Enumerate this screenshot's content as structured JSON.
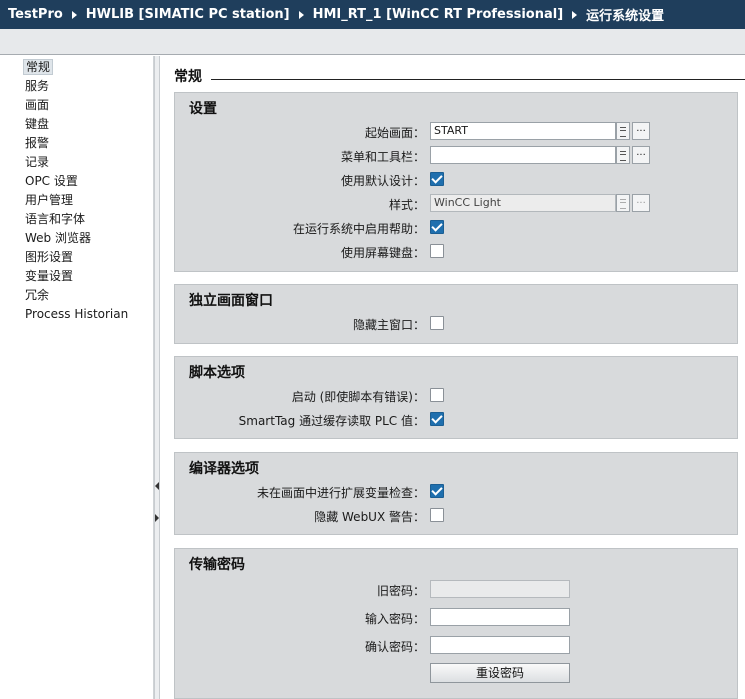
{
  "breadcrumb": [
    "TestPro",
    "HWLIB [SIMATIC PC station]",
    "HMI_RT_1 [WinCC RT Professional]",
    "运行系统设置"
  ],
  "nav": {
    "items": [
      "常规",
      "服务",
      "画面",
      "键盘",
      "报警",
      "记录",
      "OPC 设置",
      "用户管理",
      "语言和字体",
      "Web 浏览器",
      "图形设置",
      "变量设置",
      "冗余",
      "Process Historian"
    ],
    "selected": "常规"
  },
  "page": {
    "title": "常规"
  },
  "settings": {
    "title": "设置",
    "start_screen_label": "起始画面：",
    "start_screen_value": "START",
    "menu_toolbar_label": "菜单和工具栏：",
    "menu_toolbar_value": "",
    "use_default_design_label": "使用默认设计：",
    "use_default_design_checked": true,
    "style_label": "样式：",
    "style_value": "WinCC Light",
    "enable_help_label": "在运行系统中启用帮助：",
    "enable_help_checked": true,
    "screen_keyboard_label": "使用屏幕键盘：",
    "screen_keyboard_checked": false,
    "dots": "..."
  },
  "standalone_window": {
    "title": "独立画面窗口",
    "hide_main_window_label": "隐藏主窗口：",
    "hide_main_window_checked": false
  },
  "script_options": {
    "title": "脚本选项",
    "start_label": "启动 (即使脚本有错误)：",
    "start_checked": false,
    "smarttag_label": "SmartTag 通过缓存读取 PLC 值：",
    "smarttag_checked": true
  },
  "compiler_options": {
    "title": "编译器选项",
    "ext_check_label": "未在画面中进行扩展变量检查：",
    "ext_check_checked": true,
    "hide_webux_label": "隐藏 WebUX 警告：",
    "hide_webux_checked": false
  },
  "transfer_password": {
    "title": "传输密码",
    "old_password_label": "旧密码：",
    "old_password_value": "",
    "enter_password_label": "输入密码：",
    "enter_password_value": "",
    "confirm_password_label": "确认密码：",
    "confirm_password_value": "",
    "reset_button": "重设密码"
  },
  "colors": {
    "title_bar": "#1f3e5c",
    "section_bg": "#d8dadc",
    "checkbox_checked": "#1f6fae"
  }
}
